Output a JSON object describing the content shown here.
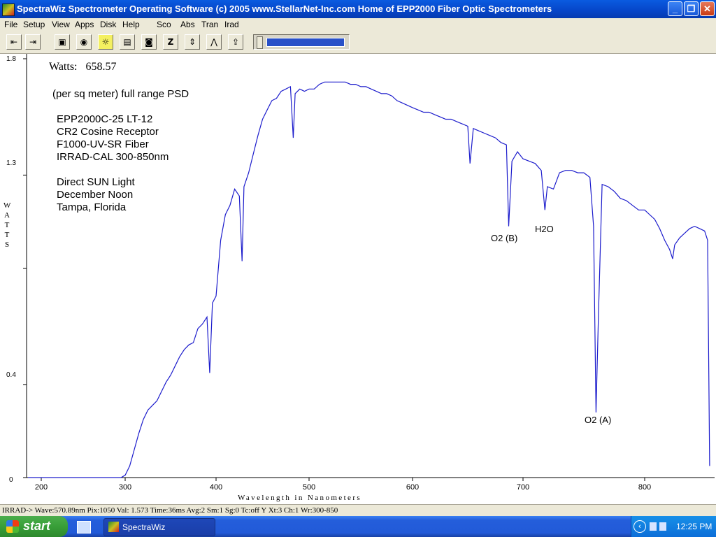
{
  "window": {
    "title": "SpectraWiz  Spectrometer Operating Software (c) 2005  www.StellarNet-Inc.com  Home of EPP2000 Fiber Optic Spectrometers",
    "minimize": "_",
    "restore": "❐",
    "close": "✕"
  },
  "menu": [
    "File",
    "Setup",
    "View",
    "Apps",
    "Disk",
    "Help",
    "Sco",
    "Abs",
    "Tran",
    "Irad"
  ],
  "toolbar": {
    "icons": [
      "scroll-left-icon",
      "scroll-right-icon",
      "monitor-icon",
      "detector-icon",
      "lamp-icon",
      "printer-icon",
      "camera-icon",
      "zero-icon",
      "scale-icon",
      "peak-icon",
      "export-icon"
    ],
    "glyphs": [
      "⇤",
      "⇥",
      "▣",
      "◉",
      "☼",
      "▤",
      "◙",
      "Z",
      "⇕",
      "⋀",
      "⇪"
    ]
  },
  "overlay": {
    "watts_label": "Watts:",
    "watts_value": "658.57",
    "psd_line": "(per sq meter) full range PSD",
    "lines": [
      "EPP2000C-25  LT-12",
      "CR2 Cosine Receptor",
      "F1000-UV-SR Fiber",
      "IRRAD-CAL 300-850nm",
      "Direct SUN Light",
      "December Noon",
      "Tampa, Florida"
    ]
  },
  "annotations": [
    "O2 (B)",
    "H2O",
    "O2 (A)"
  ],
  "chart_data": {
    "type": "line",
    "xlabel": "Wavelength in Nanometers",
    "ylabel": "W A T T S",
    "x_ticks": [
      200,
      300,
      400,
      500,
      600,
      700,
      800
    ],
    "y_ticks": [
      "1.8",
      "1.3",
      "0.4",
      "0"
    ],
    "xlim": [
      190,
      870
    ],
    "ylim": [
      0,
      1.8
    ],
    "grid": false,
    "color": "#1c1ccc",
    "x": [
      190,
      295,
      300,
      305,
      310,
      315,
      320,
      325,
      330,
      335,
      340,
      345,
      350,
      355,
      360,
      365,
      370,
      375,
      380,
      385,
      390,
      393,
      396,
      400,
      405,
      410,
      415,
      420,
      425,
      428,
      430,
      435,
      440,
      445,
      450,
      455,
      460,
      465,
      470,
      475,
      480,
      483,
      485,
      490,
      495,
      500,
      505,
      510,
      515,
      520,
      525,
      530,
      535,
      540,
      545,
      550,
      555,
      560,
      565,
      570,
      575,
      580,
      585,
      590,
      595,
      600,
      605,
      610,
      615,
      620,
      625,
      630,
      635,
      640,
      645,
      650,
      652,
      655,
      660,
      665,
      670,
      675,
      680,
      685,
      687,
      690,
      695,
      700,
      705,
      710,
      715,
      718,
      720,
      725,
      730,
      735,
      740,
      745,
      750,
      755,
      758,
      760,
      762,
      765,
      770,
      775,
      780,
      785,
      790,
      795,
      800,
      805,
      810,
      815,
      820,
      825,
      828,
      830,
      835,
      840,
      845,
      850,
      855,
      860,
      863,
      865
    ],
    "y": [
      0,
      0,
      0.01,
      0.05,
      0.12,
      0.19,
      0.25,
      0.29,
      0.31,
      0.33,
      0.37,
      0.41,
      0.44,
      0.48,
      0.52,
      0.55,
      0.57,
      0.58,
      0.64,
      0.66,
      0.69,
      0.45,
      0.75,
      0.78,
      1.02,
      1.13,
      1.17,
      1.24,
      1.21,
      0.93,
      1.25,
      1.31,
      1.39,
      1.47,
      1.54,
      1.58,
      1.62,
      1.63,
      1.66,
      1.67,
      1.68,
      1.46,
      1.65,
      1.67,
      1.66,
      1.67,
      1.67,
      1.69,
      1.7,
      1.7,
      1.7,
      1.7,
      1.7,
      1.69,
      1.69,
      1.68,
      1.68,
      1.67,
      1.66,
      1.65,
      1.65,
      1.64,
      1.62,
      1.61,
      1.6,
      1.59,
      1.58,
      1.57,
      1.57,
      1.56,
      1.55,
      1.54,
      1.54,
      1.53,
      1.52,
      1.51,
      1.35,
      1.5,
      1.49,
      1.48,
      1.47,
      1.46,
      1.44,
      1.43,
      1.08,
      1.36,
      1.4,
      1.37,
      1.36,
      1.35,
      1.32,
      1.15,
      1.25,
      1.24,
      1.31,
      1.32,
      1.32,
      1.31,
      1.31,
      1.29,
      1.08,
      0.28,
      0.7,
      1.26,
      1.25,
      1.23,
      1.2,
      1.19,
      1.17,
      1.15,
      1.15,
      1.13,
      1.11,
      1.07,
      1.02,
      0.98,
      0.94,
      1.0,
      1.03,
      1.05,
      1.07,
      1.08,
      1.07,
      1.06,
      1.02,
      0.05
    ]
  },
  "status": {
    "text": "IRRAD-> Wave:570.89nm  Pix:1050  Val:  1.573  Time:36ms  Avg:2  Sm:1  Sg:0  Tc:off Y  Xt:3  Ch:1  Wr:300-850"
  },
  "taskbar": {
    "start": "start",
    "app": "SpectraWiz",
    "clock": "12:25 PM"
  }
}
